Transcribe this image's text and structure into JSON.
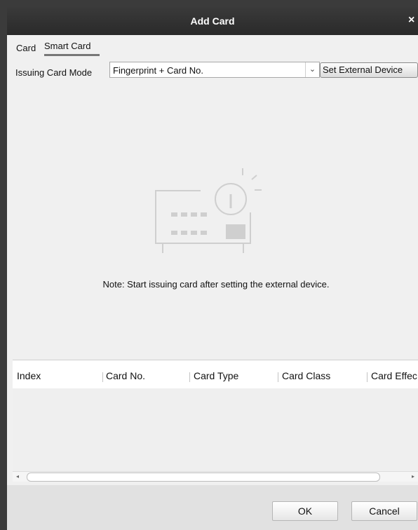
{
  "dialog": {
    "title": "Add Card",
    "close_symbol": "×"
  },
  "tabs": [
    {
      "label": "Card"
    },
    {
      "label": "Smart Card",
      "selected": true
    }
  ],
  "issuing": {
    "label": "Issuing Card Mode",
    "value": "Fingerprint + Card No.",
    "dropdown_symbol": "⌄",
    "set_device_label": "Set External Device"
  },
  "illustration": {
    "icon": "card-reader-info-icon",
    "color": "#cfcfcf"
  },
  "note": "Note: Start issuing card after setting the external device.",
  "table": {
    "columns": [
      "Index",
      "Card No.",
      "Card Type",
      "Card Class",
      "Card Effec"
    ],
    "rows": []
  },
  "scrollbar": {
    "left_arrow": "◂",
    "right_arrow": "▸"
  },
  "footer": {
    "ok_label": "OK",
    "cancel_label": "Cancel"
  }
}
